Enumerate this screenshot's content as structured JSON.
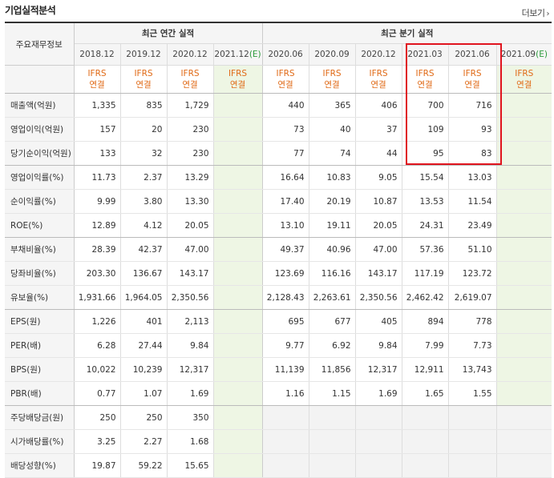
{
  "header": {
    "title": "기업실적분석",
    "more_label": "더보기"
  },
  "table": {
    "main_header": "주요재무정보",
    "groups": {
      "annual": "최근 연간 실적",
      "quarterly": "최근 분기 실적"
    },
    "annual_periods": [
      {
        "label": "2018.12",
        "estimate": false
      },
      {
        "label": "2019.12",
        "estimate": false
      },
      {
        "label": "2020.12",
        "estimate": false
      },
      {
        "label": "2021.12",
        "estimate": true
      }
    ],
    "quarterly_periods": [
      {
        "label": "2020.06",
        "estimate": false
      },
      {
        "label": "2020.09",
        "estimate": false
      },
      {
        "label": "2020.12",
        "estimate": false
      },
      {
        "label": "2021.03",
        "estimate": false
      },
      {
        "label": "2021.06",
        "estimate": false
      },
      {
        "label": "2021.09",
        "estimate": true
      }
    ],
    "estimate_suffix": "(E)",
    "ifrs_line1": "IFRS",
    "ifrs_line2": "연결",
    "rows": [
      {
        "label": "매출액(억원)",
        "annual": [
          "1,335",
          "835",
          "1,729",
          ""
        ],
        "quarterly": [
          "440",
          "365",
          "406",
          "700",
          "716",
          ""
        ]
      },
      {
        "label": "영업이익(억원)",
        "annual": [
          "157",
          "20",
          "230",
          ""
        ],
        "quarterly": [
          "73",
          "40",
          "37",
          "109",
          "93",
          ""
        ]
      },
      {
        "label": "당기순이익(억원)",
        "annual": [
          "133",
          "32",
          "230",
          ""
        ],
        "quarterly": [
          "77",
          "74",
          "44",
          "95",
          "83",
          ""
        ]
      },
      {
        "label": "영업이익률(%)",
        "annual": [
          "11.73",
          "2.37",
          "13.29",
          ""
        ],
        "quarterly": [
          "16.64",
          "10.83",
          "9.05",
          "15.54",
          "13.03",
          ""
        ]
      },
      {
        "label": "순이익률(%)",
        "annual": [
          "9.99",
          "3.80",
          "13.30",
          ""
        ],
        "quarterly": [
          "17.40",
          "20.19",
          "10.87",
          "13.53",
          "11.54",
          ""
        ]
      },
      {
        "label": "ROE(%)",
        "annual": [
          "12.89",
          "4.12",
          "20.05",
          ""
        ],
        "quarterly": [
          "13.10",
          "19.11",
          "20.05",
          "24.31",
          "23.49",
          ""
        ]
      },
      {
        "label": "부채비율(%)",
        "annual": [
          "28.39",
          "42.37",
          "47.00",
          ""
        ],
        "quarterly": [
          "49.37",
          "40.96",
          "47.00",
          "57.36",
          "51.10",
          ""
        ]
      },
      {
        "label": "당좌비율(%)",
        "annual": [
          "203.30",
          "136.67",
          "143.17",
          ""
        ],
        "quarterly": [
          "123.69",
          "116.16",
          "143.17",
          "117.19",
          "123.72",
          ""
        ]
      },
      {
        "label": "유보율(%)",
        "annual": [
          "1,931.66",
          "1,964.05",
          "2,350.56",
          ""
        ],
        "quarterly": [
          "2,128.43",
          "2,263.61",
          "2,350.56",
          "2,462.42",
          "2,619.07",
          ""
        ]
      },
      {
        "label": "EPS(원)",
        "annual": [
          "1,226",
          "401",
          "2,113",
          ""
        ],
        "quarterly": [
          "695",
          "677",
          "405",
          "894",
          "778",
          ""
        ]
      },
      {
        "label": "PER(배)",
        "annual": [
          "6.28",
          "27.44",
          "9.84",
          ""
        ],
        "quarterly": [
          "9.77",
          "6.92",
          "9.84",
          "7.99",
          "7.73",
          ""
        ]
      },
      {
        "label": "BPS(원)",
        "annual": [
          "10,022",
          "10,239",
          "12,317",
          ""
        ],
        "quarterly": [
          "11,139",
          "11,856",
          "12,317",
          "12,911",
          "13,743",
          ""
        ]
      },
      {
        "label": "PBR(배)",
        "annual": [
          "0.77",
          "1.07",
          "1.69",
          ""
        ],
        "quarterly": [
          "1.16",
          "1.15",
          "1.69",
          "1.65",
          "1.55",
          ""
        ]
      },
      {
        "label": "주당배당금(원)",
        "annual": [
          "250",
          "250",
          "350",
          ""
        ],
        "quarterly": [
          "",
          "",
          "",
          "",
          "",
          ""
        ]
      },
      {
        "label": "시가배당률(%)",
        "annual": [
          "3.25",
          "2.27",
          "1.68",
          ""
        ],
        "quarterly": [
          "",
          "",
          "",
          "",
          "",
          ""
        ]
      },
      {
        "label": "배당성향(%)",
        "annual": [
          "19.87",
          "59.22",
          "15.65",
          ""
        ],
        "quarterly": [
          "",
          "",
          "",
          "",
          "",
          ""
        ]
      }
    ]
  },
  "colors": {
    "highlight_box": "#e0141e",
    "ifrs_text": "#e06a16",
    "estimate_text": "#2a9a3a",
    "estimate_bg": "#eef6e4"
  }
}
